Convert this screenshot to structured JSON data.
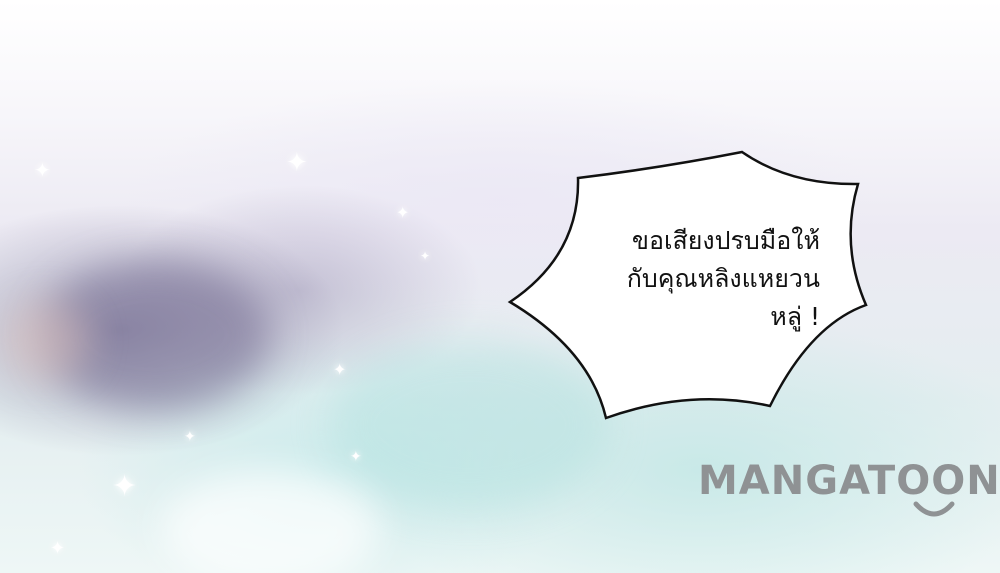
{
  "speech_bubble": {
    "lines": [
      "ขอเสียงปรบมือให้",
      "กับคุณหลิงแหยวน",
      "หลู่ !"
    ]
  },
  "watermark": {
    "text": "MANGATOON",
    "color": "#8f9294"
  },
  "icons": [
    "sparkle-icon",
    "smile-icon"
  ]
}
